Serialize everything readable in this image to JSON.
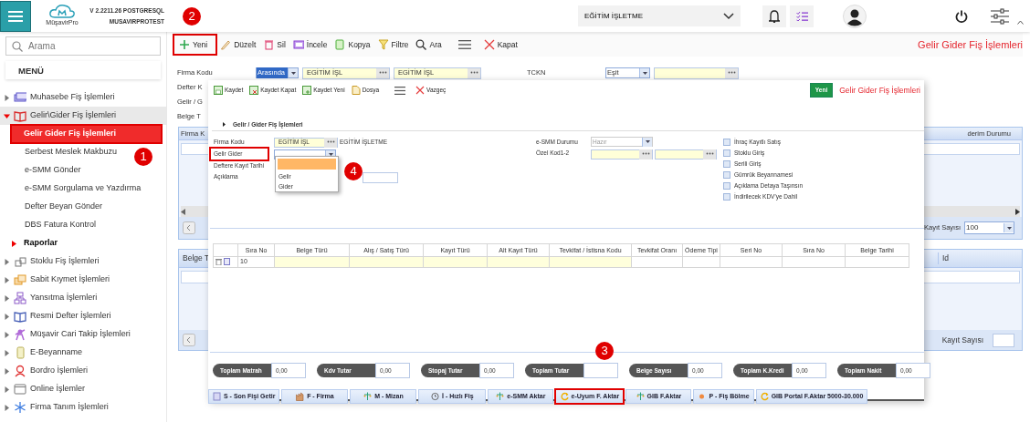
{
  "header": {
    "logo": "MüşavirPro",
    "version": "V 2.2211.26 POSTGRESQL",
    "instance": "MUSAVIRPROTEST",
    "company": "EĞİTİM İŞLETME"
  },
  "sidebar": {
    "search_placeholder": "Arama",
    "menu_title": "MENÜ",
    "items": [
      {
        "label": "Muhasebe Fiş İşlemleri",
        "expanded": false
      },
      {
        "label": "Gelir\\Gider Fiş İşlemleri",
        "expanded": true,
        "children": [
          {
            "label": "Gelir Gider Fiş İşlemleri",
            "kind": "link",
            "selected": true,
            "callout": true
          },
          {
            "label": "Serbest Meslek Makbuzu",
            "kind": "link",
            "selected": false,
            "callout": false
          },
          {
            "label": "e-SMM Gönder",
            "kind": "link",
            "selected": false,
            "callout": false
          },
          {
            "label": "e-SMM Sorgulama ve Yazdırma",
            "kind": "link",
            "selected": false,
            "callout": false
          },
          {
            "label": "Defter Beyan Gönder",
            "kind": "link",
            "selected": false,
            "callout": false
          },
          {
            "label": "DBS Fatura Kontrol",
            "kind": "link",
            "selected": false,
            "callout": false
          },
          {
            "label": "Raporlar",
            "kind": "folder",
            "selected": false,
            "callout": false
          }
        ]
      },
      {
        "label": "Stoklu Fiş İşlemleri",
        "expanded": false
      },
      {
        "label": "Sabit Kıymet İşlemleri",
        "expanded": false
      },
      {
        "label": "Yansıtma İşlemleri",
        "expanded": false
      },
      {
        "label": "Resmi Defter İşlemleri",
        "expanded": false
      },
      {
        "label": "Müşavir Cari Takip İşlemleri",
        "expanded": false
      },
      {
        "label": "E-Beyanname",
        "expanded": false
      },
      {
        "label": "Bordro İşlemleri",
        "expanded": false
      },
      {
        "label": "Online İşlemler",
        "expanded": false
      },
      {
        "label": "Firma Tanım İşlemleri",
        "expanded": false
      }
    ]
  },
  "toolbar": {
    "title": "Gelir Gider Fiş İşlemleri",
    "buttons": [
      {
        "label": "Yeni",
        "callout": true
      },
      {
        "label": "Düzelt",
        "callout": false
      },
      {
        "label": "Sil",
        "callout": false
      },
      {
        "label": "İncele",
        "callout": false
      },
      {
        "label": "Kopya",
        "callout": false
      },
      {
        "label": "Filtre",
        "callout": false
      },
      {
        "label": "Ara",
        "callout": false
      },
      {
        "label": "Kapat",
        "callout": false
      }
    ]
  },
  "filter": {
    "firma": {
      "label": "Firma Kodu",
      "operator": "Arasında",
      "operator_text_selected": true,
      "from": "EGİTİM İŞL",
      "to": "EGİTİM İŞL"
    },
    "tckn": {
      "label": "TCKN",
      "operator": "Eşit"
    },
    "other_labels": [
      "Defter K",
      "Gelir / G",
      "Belge T"
    ]
  },
  "list_grid": {
    "column_1": "Firma K",
    "column_2": "derim Durumu",
    "count_label": "Kayıt Sayısı",
    "page_size": "100"
  },
  "detail_grid": {
    "column_1": "Belge T",
    "column_3": "Id",
    "count_label": "Kayıt Sayısı"
  },
  "modal": {
    "toolbar": [
      "Kaydet",
      "Kaydet Kapat",
      "Kaydet Yeni",
      "Dosya",
      "Vazgeç"
    ],
    "new_button": "Yeni",
    "title": "Gelir Gider Fiş İşlemleri",
    "section": "Gelir / Gider Fiş İşlemleri",
    "fields": {
      "firma_label": "Firma Kodu",
      "firma_code": "EGİTİM İŞL",
      "firma_name": "EGİTİM İŞLETME",
      "type_label": "Gelir Gider",
      "type_label_callout": true,
      "date_label": "Deftere Kayıt Tarihi",
      "note_label": "Açıklama",
      "esmm_label": "e-SMM Durumu",
      "esmm_value": "Hazır",
      "special_label": "Özel Kod1-2"
    },
    "dropdown": {
      "open": true,
      "blank_highlighted": true,
      "options": [
        {
          "label": "Gelir",
          "selected": false
        },
        {
          "label": "Gider",
          "selected": false
        }
      ]
    },
    "checkboxes": [
      {
        "label": "İhraç Kayıtlı Satış",
        "checked": false
      },
      {
        "label": "Stoklu Giriş",
        "checked": false
      },
      {
        "label": "Serili Giriş",
        "checked": false
      },
      {
        "label": "Gümrük Beyannamesi",
        "checked": false
      },
      {
        "label": "Açıklama Detaya Taşınsın",
        "checked": false
      },
      {
        "label": "İndirilecek KDV'ye Dahil",
        "checked": false
      }
    ],
    "table": {
      "columns": [
        "Sıra No",
        "Belge Türü",
        "Alış / Satış Türü",
        "Kayıt Türü",
        "Alt Kayıt Türü",
        "Tevkifat / İstisna Kodu",
        "Tevkifat Oranı",
        "Ödeme Tipi",
        "Seri No",
        "Sıra No",
        "Belge Tarihi"
      ],
      "rows": [
        [
          "10",
          "",
          "",
          "",
          "",
          "",
          "",
          "",
          "",
          "",
          ""
        ]
      ]
    },
    "totals": [
      {
        "label": "Toplam Matrah",
        "value": "0,00"
      },
      {
        "label": "Kdv Tutar",
        "value": "0,00"
      },
      {
        "label": "Stopaj Tutar",
        "value": "0,00"
      },
      {
        "label": "Toplam Tutar"
      },
      {
        "label": "Belge Sayısı",
        "value": "0,00"
      },
      {
        "label": "Toplam K.Kredi",
        "value": "0,00"
      },
      {
        "label": "Toplam Nakit",
        "value": "0,00"
      }
    ],
    "actions": [
      {
        "label": "S - Son Fişi Getir",
        "callout": false
      },
      {
        "label": "F - Firma",
        "callout": false
      },
      {
        "label": "M - Mizan",
        "callout": false
      },
      {
        "label": "İ - Hızlı Fiş",
        "callout": false
      },
      {
        "label": "e-SMM Aktar",
        "callout": false
      },
      {
        "label": "e-Uyum F. Aktar",
        "callout": true
      },
      {
        "label": "GIB F.Aktar",
        "callout": false
      },
      {
        "label": "P - Fiş Bölme",
        "callout": false
      },
      {
        "label": "GIB Portal F.Aktar 5000-30.000",
        "callout": false
      }
    ]
  },
  "annotations": [
    "1",
    "2",
    "3",
    "4"
  ]
}
